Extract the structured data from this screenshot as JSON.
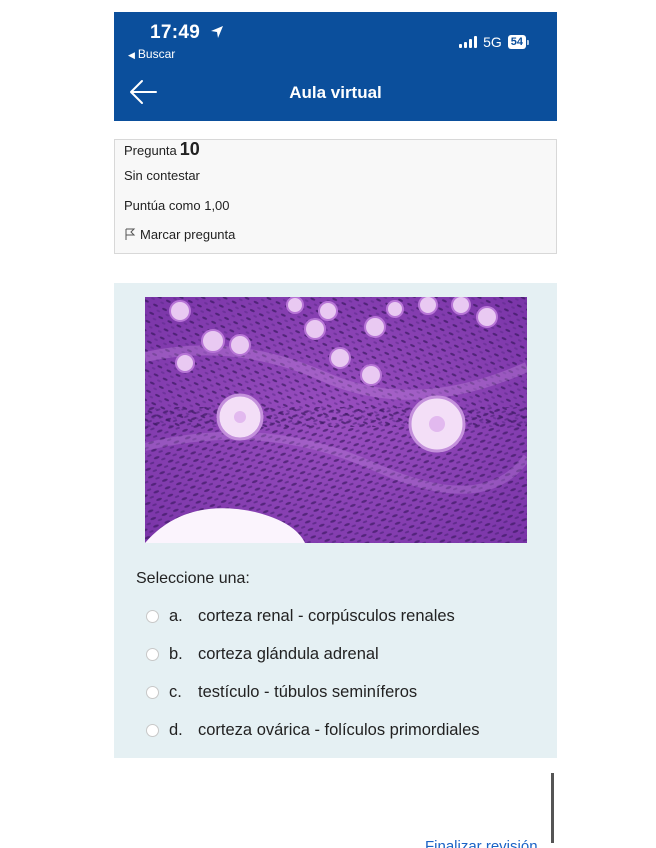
{
  "status_bar": {
    "time": "17:49",
    "back_app": "Buscar",
    "network": "5G",
    "battery": "54"
  },
  "header": {
    "title": "Aula virtual",
    "back_icon": "arrow-left-icon",
    "color": "#0b4f9c"
  },
  "question": {
    "label": "Pregunta",
    "number": "10",
    "status": "Sin contestar",
    "score": "Puntúa como 1,00",
    "flag_label": "Marcar pregunta",
    "flag_icon": "flag-icon"
  },
  "content": {
    "image_description_icon": "histology-image",
    "prompt": "Seleccione una:",
    "options": [
      {
        "letter": "a.",
        "text": "corteza renal - corpúsculos renales"
      },
      {
        "letter": "b.",
        "text": "corteza glándula adrenal"
      },
      {
        "letter": "c.",
        "text": "testículo - túbulos seminíferos"
      },
      {
        "letter": "d.",
        "text": "corteza ovárica - folículos primordiales"
      }
    ]
  },
  "footer": {
    "finish_link": "Finalizar revisión"
  },
  "colors": {
    "accent": "#0b4f9c",
    "content_bg": "#e5f0f3",
    "link": "#1a63c6"
  }
}
